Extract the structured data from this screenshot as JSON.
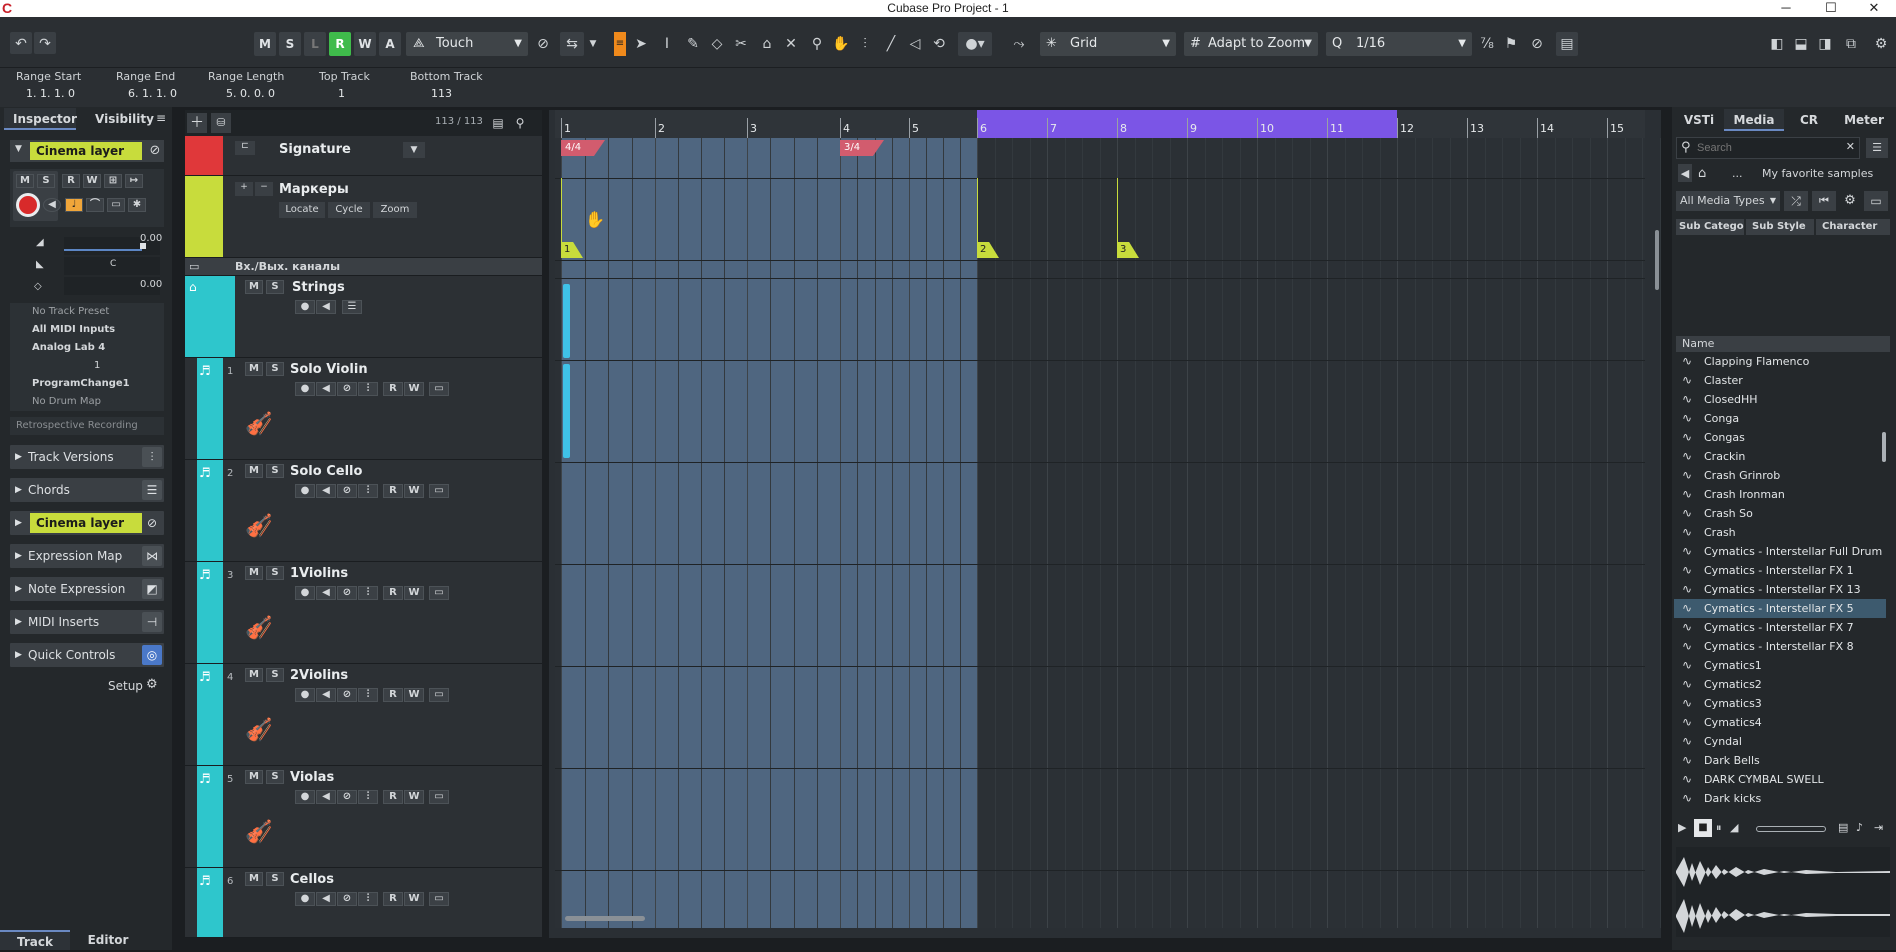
{
  "window": {
    "title": "Cubase Pro Project - 1"
  },
  "toolbar": {
    "mode_buttons": [
      "M",
      "S",
      "L",
      "R",
      "W",
      "A"
    ],
    "automation_mode": "Touch",
    "snap_type": "Grid",
    "grid_type": "Adapt to Zoom",
    "quantize": "1/16"
  },
  "infoline": {
    "range_start_label": "Range Start",
    "range_start": "1. 1. 1.   0",
    "range_end_label": "Range End",
    "range_end": "6. 1. 1.   0",
    "range_length_label": "Range Length",
    "range_length": "5. 0. 0.   0",
    "top_track_label": "Top Track",
    "top_track": "1",
    "bottom_track_label": "Bottom Track",
    "bottom_track": "113"
  },
  "inspector": {
    "tabs": [
      "Inspector",
      "Visibility"
    ],
    "track_name": "Cinema layer",
    "vol_value": "0.00",
    "pan_value": "C",
    "delay_value": "0.00",
    "track_preset": "No Track Preset",
    "midi_input": "All MIDI Inputs",
    "midi_output": "Analog Lab 4",
    "channel": "1",
    "program": "ProgramChange1",
    "drum_map": "No Drum Map",
    "retro": "Retrospective Recording",
    "sections": [
      "Track Versions",
      "Chords",
      "Cinema layer",
      "Expression Map",
      "Note Expression",
      "MIDI Inserts",
      "Quick Controls"
    ],
    "setup": "Setup",
    "bottom_tabs": [
      "Track",
      "Editor"
    ]
  },
  "tracklist": {
    "count": "113 / 113",
    "signature": "Signature",
    "markers": "Маркеры",
    "marker_buttons": [
      "Locate",
      "Cycle",
      "Zoom"
    ],
    "io_channels": "Вх./Вых. каналы",
    "folder": "Strings",
    "tracks": [
      {
        "num": "1",
        "name": "Solo Violin"
      },
      {
        "num": "2",
        "name": "Solo Cello"
      },
      {
        "num": "3",
        "name": "1Violins"
      },
      {
        "num": "4",
        "name": "2Violins"
      },
      {
        "num": "5",
        "name": "Violas"
      },
      {
        "num": "6",
        "name": "Cellos"
      }
    ]
  },
  "ruler": {
    "bars": [
      "1",
      "2",
      "3",
      "4",
      "5",
      "6",
      "7",
      "8",
      "9",
      "10",
      "11",
      "12",
      "13",
      "14",
      "15"
    ]
  },
  "signatures": [
    "4/4",
    "3/4"
  ],
  "markers": [
    "1",
    "2",
    "3"
  ],
  "mediabay": {
    "tabs": [
      "VSTi",
      "Media",
      "CR",
      "Meter"
    ],
    "search_placeholder": "Search",
    "breadcrumb": "...",
    "folder": "My favorite samples",
    "filter": "All Media Types",
    "columns": [
      "Sub Catego",
      "Sub Style",
      "Character"
    ],
    "list_header": "Name",
    "items": [
      "Clapping Flamenco",
      "Claster",
      "ClosedHH",
      "Conga",
      "Congas",
      "Crackin",
      "Crash Grinrob",
      "Crash Ironman",
      "Crash So",
      "Crash",
      "Cymatics - Interstellar Full Drum L",
      "Cymatics - Interstellar FX 1",
      "Cymatics - Interstellar FX 13",
      "Cymatics - Interstellar FX 5",
      "Cymatics - Interstellar FX 7",
      "Cymatics - Interstellar FX 8",
      "Cymatics1",
      "Cymatics2",
      "Cymatics3",
      "Cymatics4",
      "Cyndal",
      "Dark Bells",
      "DARK CYMBAL SWELL",
      "Dark kicks"
    ],
    "selected_index": 13
  }
}
